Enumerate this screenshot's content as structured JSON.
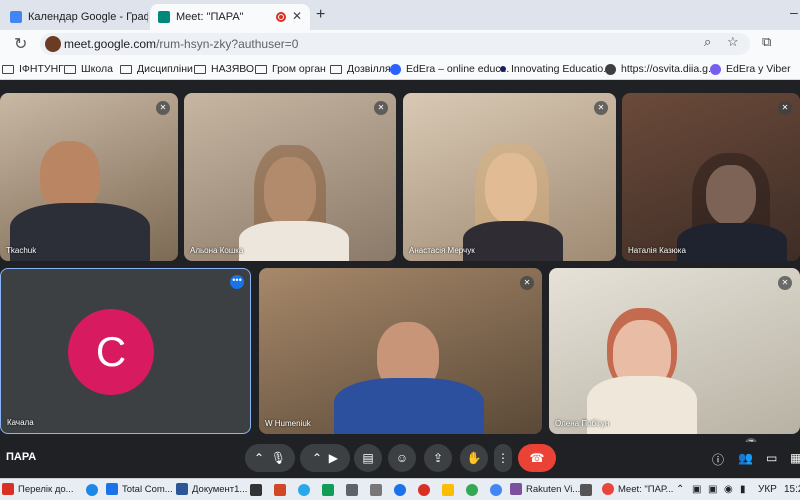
{
  "browser": {
    "tabs": [
      {
        "title": "Календар Google - Графік поч",
        "active": false
      },
      {
        "title": "Meet: \"ПАРА\"",
        "active": true
      }
    ],
    "new_tab": "+",
    "close_glyph": "✕",
    "url_host": "meet.google.com",
    "url_path": "/rum-hsyn-zky?authuser=0",
    "bookmarks": [
      {
        "label": "ІФНТУНГ",
        "icon": "folder"
      },
      {
        "label": "Школа",
        "icon": "folder"
      },
      {
        "label": "Дисципліни",
        "icon": "folder"
      },
      {
        "label": "НАЗЯВО",
        "icon": "folder"
      },
      {
        "label": "Гром орган",
        "icon": "folder"
      },
      {
        "label": "Дозвілля",
        "icon": "folder"
      },
      {
        "label": "EdEra – online educ...",
        "icon": "edera"
      },
      {
        "label": "Innovating Educatio...",
        "icon": "dot"
      },
      {
        "label": "https://osvita.diia.g...",
        "icon": "globe"
      },
      {
        "label": "EdEra у Viber",
        "icon": "viber"
      }
    ]
  },
  "meet": {
    "tiles": [
      {
        "name": "Tkachuk",
        "muted": true
      },
      {
        "name": "Альона Кошка",
        "muted": true
      },
      {
        "name": "Анастасія Мерчук",
        "muted": true
      },
      {
        "name": "Наталія Казюка",
        "muted": true
      },
      {
        "name": "Качала",
        "avatar_letter": "C",
        "avatar_color": "#d81b60"
      },
      {
        "name": "W Humeniuk",
        "muted": true
      },
      {
        "name": "Олена Побігун",
        "muted": true
      }
    ],
    "meeting_name": "ПАРА",
    "participant_count": "7",
    "colors": {
      "end_call": "#ea4335",
      "control_bg": "#3c4043",
      "active_border": "#8ab4f8"
    }
  },
  "taskbar": {
    "items": [
      {
        "label": "Перелік до...",
        "color": "#d93025"
      },
      {
        "label": "Total Com...",
        "color": "#1a73e8"
      },
      {
        "label": "Документ1...",
        "color": "#2b579a"
      },
      {
        "label": "Rakuten Vi...",
        "color": "#7b519d"
      },
      {
        "label": "Meet: \"ПАР...",
        "color": "#e8453c"
      }
    ],
    "lang": "УКР",
    "time": "15:2"
  }
}
